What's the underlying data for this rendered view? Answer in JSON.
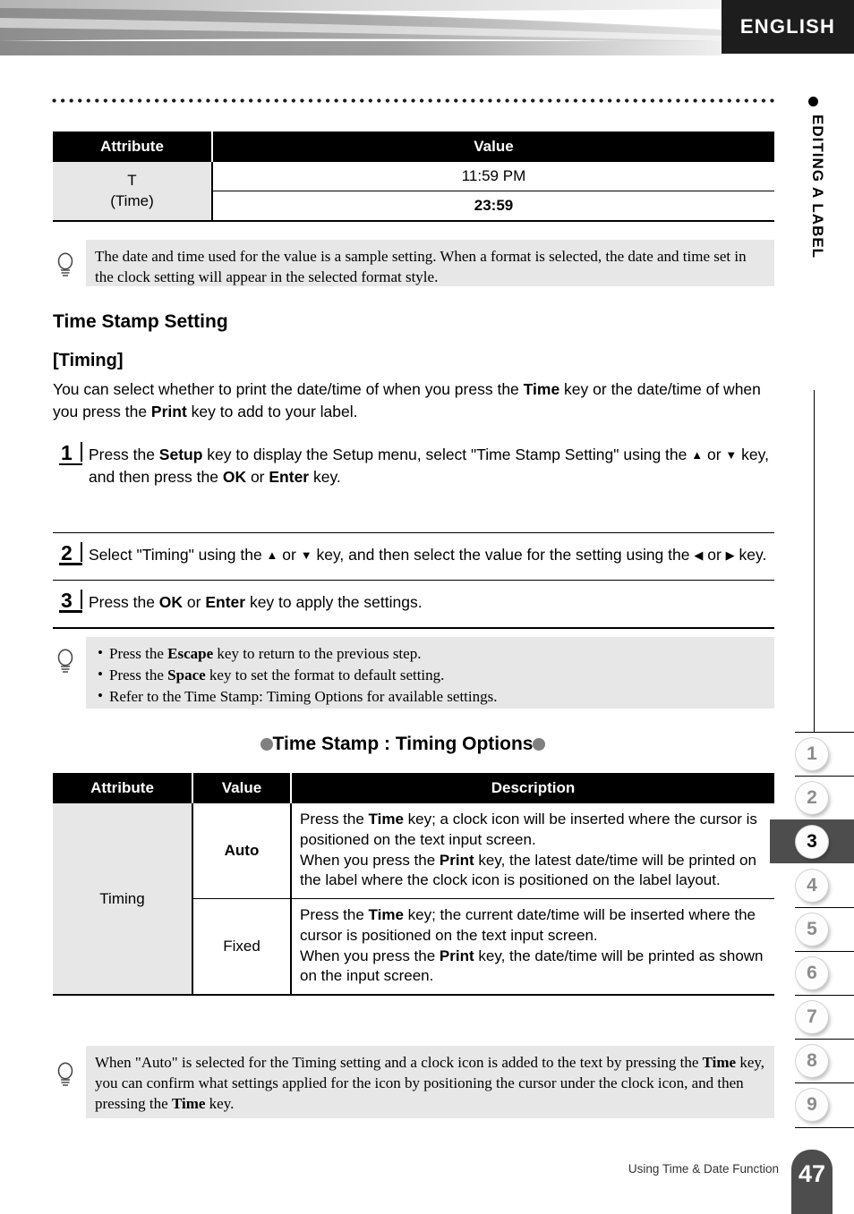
{
  "banner": {
    "language_tab": "ENGLISH"
  },
  "rail": {
    "section_title": "EDITING A LABEL",
    "chapter_tabs": [
      "1",
      "2",
      "3",
      "4",
      "5",
      "6",
      "7",
      "8",
      "9"
    ],
    "active_chapter": "3",
    "page_number": "47",
    "footer_text": "Using Time & Date Function"
  },
  "top_table": {
    "headers": {
      "attribute": "Attribute",
      "value": "Value"
    },
    "rows": [
      {
        "attribute_line1": "T",
        "attribute_line2": "(Time)",
        "values": [
          "11:59 PM",
          "23:59"
        ]
      }
    ]
  },
  "tip_top": {
    "text": "The date and time used for the value is a sample setting. When a format is selected, the date and time set in the clock setting will appear in the selected format style."
  },
  "headings": {
    "section": "Time Stamp Setting",
    "subsection": "[Timing]"
  },
  "intro": {
    "part1": "You can select whether to print the date/time of when you press the ",
    "bold1": "Time",
    "part2": " key or the date/time of when you press the ",
    "bold2": "Print",
    "part3": " key to add to your label."
  },
  "steps": [
    {
      "number": "1",
      "t1": "Press the ",
      "b1": "Setup",
      "t2": " key to display the Setup menu, select \"Time Stamp Setting\" using the ",
      "a1": "▲",
      "t3": " or ",
      "a2": "▼",
      "t4": " key, and then press the ",
      "b2": "OK",
      "t5": " or ",
      "b3": "Enter",
      "t6": " key."
    },
    {
      "number": "2",
      "t1": "Select \"Timing\" using the ",
      "a1": "▲",
      "t2": " or ",
      "a2": "▼",
      "t3": " key, and then select the value for the setting using the ",
      "a3": "◀",
      "t4": " or ",
      "a4": "▶",
      "t5": " key."
    },
    {
      "number": "3",
      "t1": "Press the ",
      "b1": "OK",
      "t2": " or ",
      "b2": "Enter",
      "t3": " key to apply the settings."
    }
  ],
  "tip_middle": {
    "items": [
      {
        "t1": "Press the ",
        "b1": "Escape",
        "t2": " key to return to the previous step."
      },
      {
        "t1": "Press the ",
        "b1": "Space",
        "t2": " key to set the format to default setting."
      },
      {
        "t1": "Refer to the Time Stamp: Timing Options for available settings.",
        "b1": "",
        "t2": ""
      }
    ]
  },
  "options_heading": {
    "text": "Time Stamp : Timing Options"
  },
  "bottom_table": {
    "headers": {
      "attribute": "Attribute",
      "value": "Value",
      "description": "Description"
    },
    "attribute": "Timing",
    "rows": [
      {
        "value": "Auto",
        "d1": "Press the ",
        "db1": "Time",
        "d2": " key; a clock icon will be inserted where the cursor is positioned on the text input screen.",
        "d3": "When you press the ",
        "db2": "Print",
        "d4": " key, the latest date/time will be printed on the label where the clock icon is positioned on the label layout."
      },
      {
        "value": "Fixed",
        "d1": "Press the ",
        "db1": "Time",
        "d2": " key; the current date/time will be inserted where the cursor is positioned on the text input screen.",
        "d3": "When you press the ",
        "db2": "Print",
        "d4": " key, the date/time will be printed as shown on the input screen."
      }
    ]
  },
  "tip_bottom": {
    "t1": "When \"Auto\" is selected for the Timing setting and a clock icon is added to the text by pressing the ",
    "b1": "Time",
    "t2": " key, you can confirm what settings applied for the icon by positioning the cursor under the clock icon, and then pressing the ",
    "b2": "Time",
    "t3": " key."
  },
  "colors": {
    "accent_dark": "#1d1d1d",
    "tip_background": "#e7e7e7",
    "table_header": "#000000",
    "rail_active": "#4d4d4d",
    "bullet_gray": "#808080"
  }
}
